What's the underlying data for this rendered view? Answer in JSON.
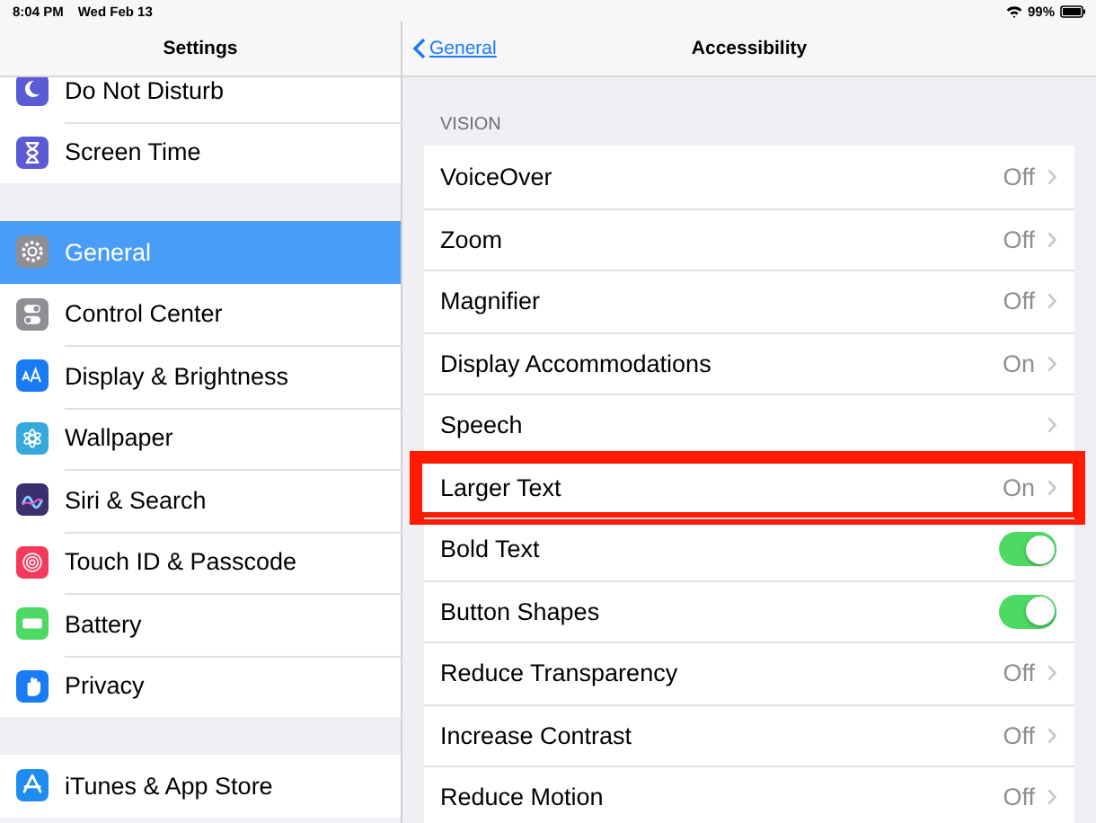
{
  "status_bar": {
    "time": "8:04 PM",
    "date": "Wed Feb 13",
    "battery": "99%"
  },
  "sidebar": {
    "title": "Settings",
    "groups": [
      {
        "items": [
          {
            "label": "Do Not Disturb",
            "color": "#5b5bd6",
            "selected": false
          },
          {
            "label": "Screen Time",
            "color": "#5b5bd6",
            "selected": false
          }
        ]
      },
      {
        "items": [
          {
            "label": "General",
            "color": "#8e8e93",
            "selected": true
          },
          {
            "label": "Control Center",
            "color": "#8e8e93",
            "selected": false
          },
          {
            "label": "Display & Brightness",
            "color": "#1a7cf5",
            "selected": false
          },
          {
            "label": "Wallpaper",
            "color": "#36a9dc",
            "selected": false
          },
          {
            "label": "Siri & Search",
            "color": "#3b2f6e",
            "selected": false
          },
          {
            "label": "Touch ID & Passcode",
            "color": "#f5395a",
            "selected": false
          },
          {
            "label": "Battery",
            "color": "#4cd964",
            "selected": false
          },
          {
            "label": "Privacy",
            "color": "#1a7cf5",
            "selected": false
          }
        ]
      },
      {
        "items": [
          {
            "label": "iTunes & App Store",
            "color": "#1d8cf0",
            "selected": false
          }
        ]
      }
    ]
  },
  "detail": {
    "back": "General",
    "title": "Accessibility",
    "sections": [
      {
        "header": "VISION",
        "rows": [
          {
            "kind": "link",
            "label": "VoiceOver",
            "value": "Off"
          },
          {
            "kind": "link",
            "label": "Zoom",
            "value": "Off"
          },
          {
            "kind": "link",
            "label": "Magnifier",
            "value": "Off"
          },
          {
            "kind": "link",
            "label": "Display Accommodations",
            "value": "On"
          },
          {
            "kind": "link",
            "label": "Speech"
          },
          {
            "kind": "link",
            "label": "Larger Text",
            "value": "On",
            "highlighted": true
          },
          {
            "kind": "toggle",
            "label": "Bold Text",
            "on": true
          },
          {
            "kind": "toggle",
            "label": "Button Shapes",
            "on": true
          },
          {
            "kind": "link",
            "label": "Reduce Transparency",
            "value": "Off"
          },
          {
            "kind": "link",
            "label": "Increase Contrast",
            "value": "Off"
          },
          {
            "kind": "link",
            "label": "Reduce Motion",
            "value": "Off"
          }
        ]
      }
    ]
  }
}
